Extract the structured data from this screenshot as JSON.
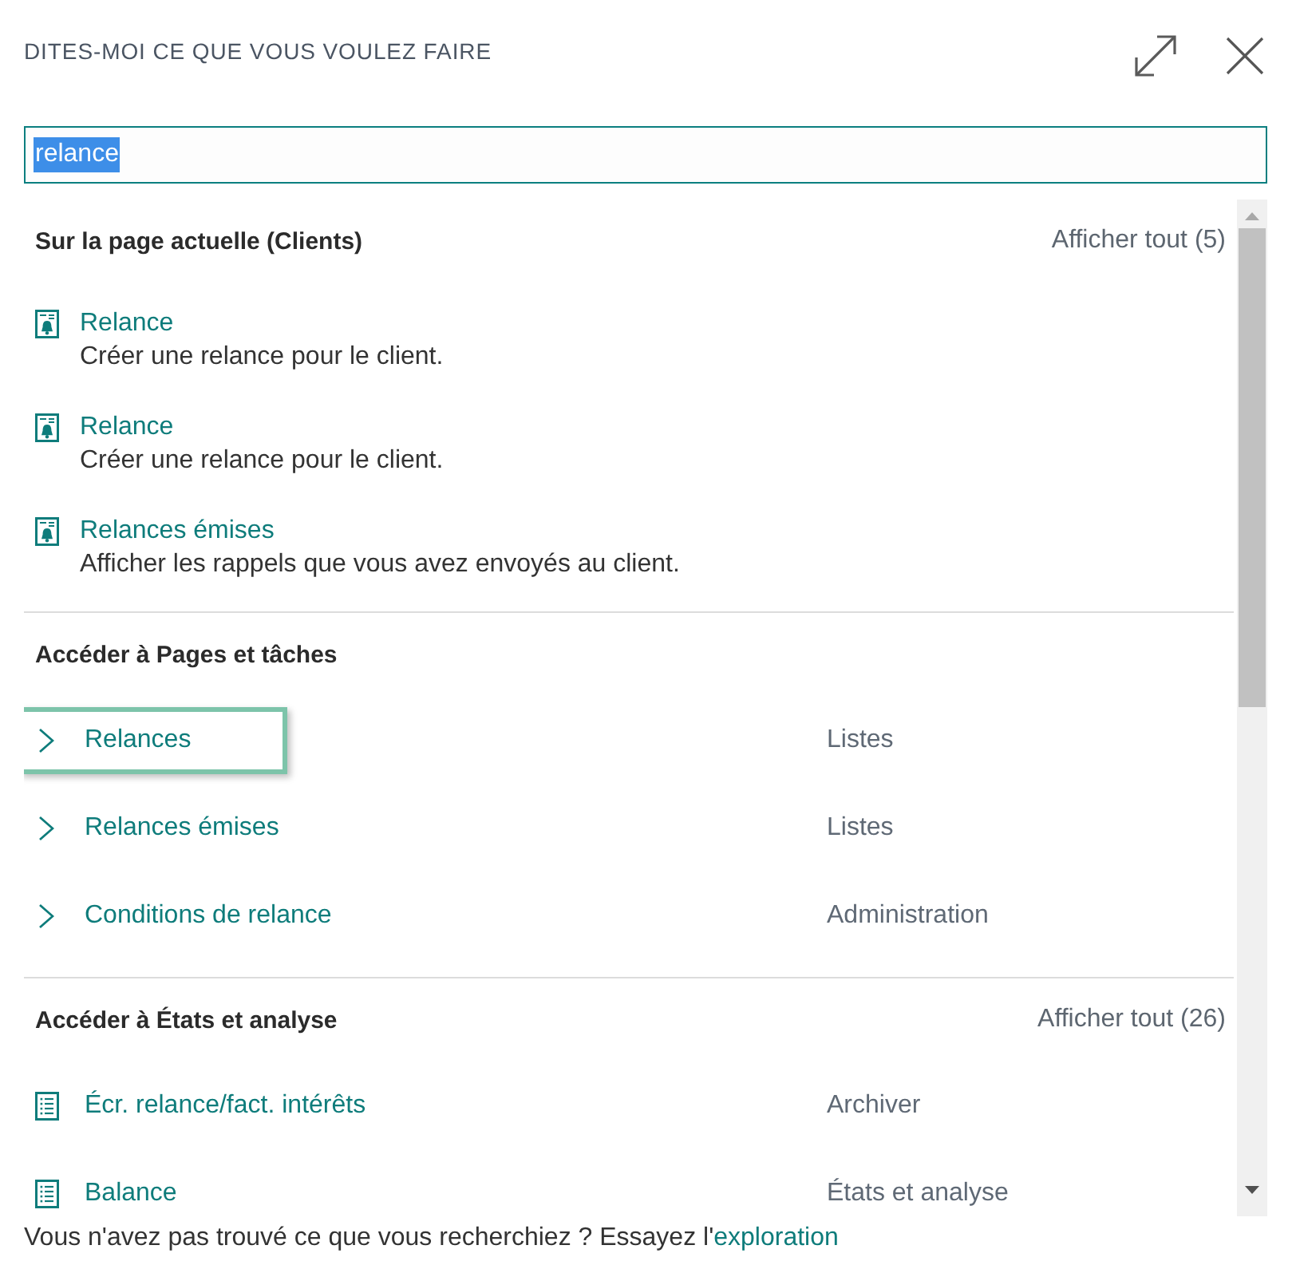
{
  "dialog": {
    "title": "DITES-MOI CE QUE VOUS VOULEZ FAIRE"
  },
  "search": {
    "value": "relance",
    "highlighted": true
  },
  "sections": [
    {
      "title": "Sur la page actuelle (Clients)",
      "show_all": "Afficher tout (5)",
      "items": [
        {
          "kind": "action",
          "title": "Relance",
          "description": "Créer une relance pour le client.",
          "selected": false
        },
        {
          "kind": "action",
          "title": "Relance",
          "description": "Créer une relance pour le client.",
          "selected": false
        },
        {
          "kind": "action",
          "title": "Relances émises",
          "description": "Afficher les rappels que vous avez envoyés au client.",
          "selected": false
        }
      ]
    },
    {
      "title": "Accéder à Pages et tâches",
      "items": [
        {
          "kind": "page",
          "title": "Relances",
          "category": "Listes",
          "selected": true
        },
        {
          "kind": "page",
          "title": "Relances émises",
          "category": "Listes",
          "selected": false
        },
        {
          "kind": "page",
          "title": "Conditions de relance",
          "category": "Administration",
          "selected": false
        }
      ]
    },
    {
      "title": "Accéder à États et analyse",
      "show_all": "Afficher tout (26)",
      "items": [
        {
          "kind": "report",
          "title": "Écr. relance/fact. intérêts",
          "category": "Archiver",
          "selected": false
        },
        {
          "kind": "report",
          "title": "Balance",
          "category": "États et analyse",
          "selected": false
        }
      ]
    }
  ],
  "footer": {
    "text": "Vous n'avez pas trouvé ce que vous recherchiez ? Essayez l'",
    "link": "exploration"
  }
}
